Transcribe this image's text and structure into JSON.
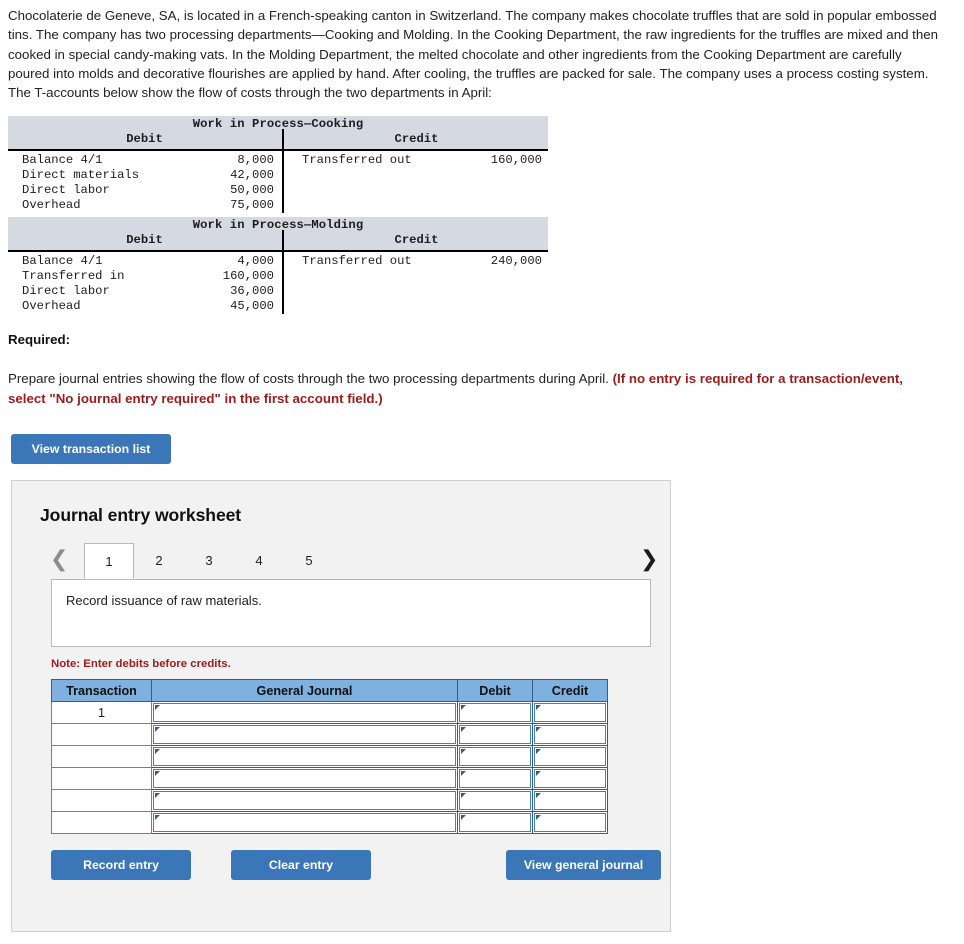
{
  "problem": {
    "narrative": "Chocolaterie de Geneve, SA, is located in a French-speaking canton in Switzerland. The company makes chocolate truffles that are sold in popular embossed tins. The company has two processing departments—Cooking and Molding. In the Cooking Department, the raw ingredients for the truffles are mixed and then cooked in special candy-making vats. In the Molding Department, the melted chocolate and other ingredients from the Cooking Department are carefully poured into molds and decorative flourishes are applied by hand. After cooling, the truffles are packed for sale. The company uses a process costing system. The T-accounts below show the flow of costs through the two departments in April:"
  },
  "taccounts": [
    {
      "title": "Work in Process—Cooking",
      "debit_label": "Debit",
      "credit_label": "Credit",
      "debit_rows": [
        {
          "label": "Balance 4/1",
          "amount": "8,000"
        },
        {
          "label": "Direct materials",
          "amount": "42,000"
        },
        {
          "label": "Direct labor",
          "amount": "50,000"
        },
        {
          "label": "Overhead",
          "amount": "75,000"
        }
      ],
      "credit_rows": [
        {
          "label": "Transferred out",
          "amount": "160,000"
        }
      ]
    },
    {
      "title": "Work in Process—Molding",
      "debit_label": "Debit",
      "credit_label": "Credit",
      "debit_rows": [
        {
          "label": "Balance 4/1",
          "amount": "4,000"
        },
        {
          "label": "Transferred in",
          "amount": "160,000"
        },
        {
          "label": "Direct labor",
          "amount": "36,000"
        },
        {
          "label": "Overhead",
          "amount": "45,000"
        }
      ],
      "credit_rows": [
        {
          "label": "Transferred out",
          "amount": "240,000"
        }
      ]
    }
  ],
  "required": {
    "heading": "Required:",
    "text": "Prepare journal entries showing the flow of costs through the two processing departments during April. ",
    "emphasis": "(If no entry is required for a transaction/event, select \"No journal entry required\" in the first account field.)"
  },
  "view_transaction_list_label": "View transaction list",
  "worksheet": {
    "title": "Journal entry worksheet",
    "prev_icon": "chevron-left-icon",
    "next_icon": "chevron-right-icon",
    "tabs": [
      {
        "label": "1",
        "active": true
      },
      {
        "label": "2",
        "active": false
      },
      {
        "label": "3",
        "active": false
      },
      {
        "label": "4",
        "active": false
      },
      {
        "label": "5",
        "active": false
      }
    ],
    "description": "Record issuance of raw materials.",
    "note": "Note: Enter debits before credits.",
    "table": {
      "headers": [
        "Transaction",
        "General Journal",
        "Debit",
        "Credit"
      ],
      "rows": [
        {
          "transaction": "1",
          "general_journal": "",
          "debit": "",
          "credit": ""
        },
        {
          "transaction": "",
          "general_journal": "",
          "debit": "",
          "credit": ""
        },
        {
          "transaction": "",
          "general_journal": "",
          "debit": "",
          "credit": ""
        },
        {
          "transaction": "",
          "general_journal": "",
          "debit": "",
          "credit": ""
        },
        {
          "transaction": "",
          "general_journal": "",
          "debit": "",
          "credit": ""
        },
        {
          "transaction": "",
          "general_journal": "",
          "debit": "",
          "credit": ""
        }
      ]
    },
    "buttons": {
      "record": "Record entry",
      "clear": "Clear entry",
      "view_general_journal": "View general journal"
    }
  },
  "colors": {
    "button_blue": "#3a76b8",
    "table_header_blue": "#7eb0e0",
    "tacct_header_gray": "#d5d9e2",
    "panel_gray": "#f2f2f2",
    "warning_red": "#9c1b1b"
  }
}
